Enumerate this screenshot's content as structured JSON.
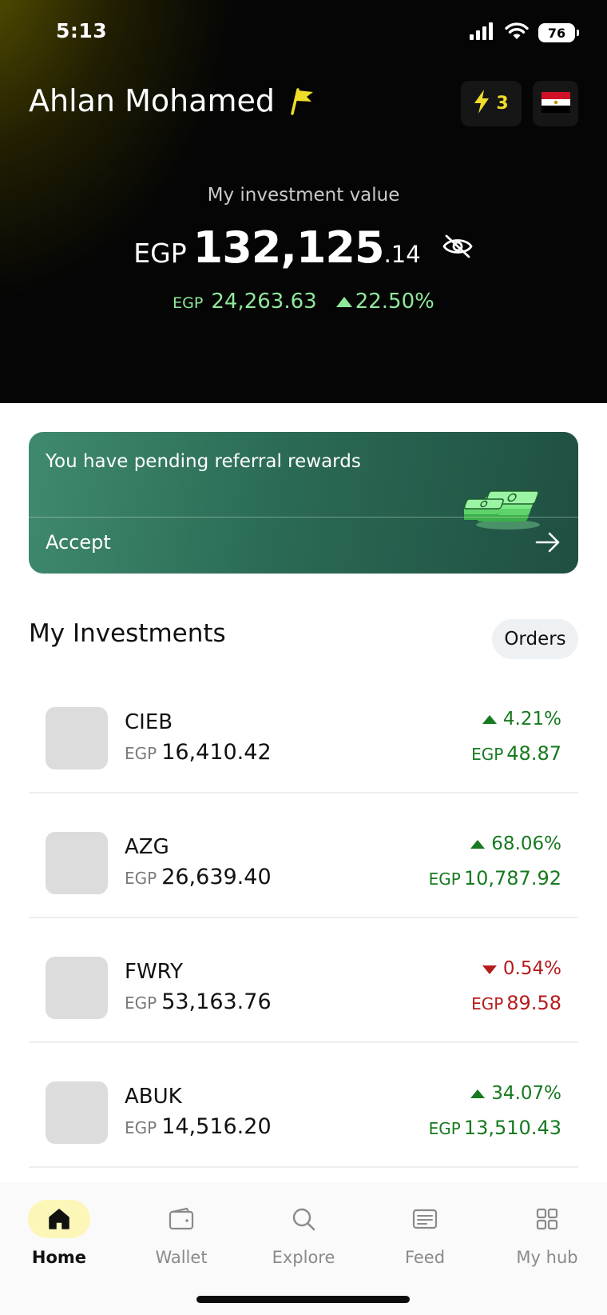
{
  "status_bar": {
    "time": "5:13",
    "battery": "76",
    "icons": [
      "cellular-signal-icon",
      "wifi-icon",
      "battery-icon"
    ]
  },
  "header": {
    "greeting": "Ahlan Mohamed",
    "streak_count": "3",
    "country": "Egypt"
  },
  "portfolio": {
    "label": "My investment value",
    "currency": "EGP",
    "value_main": "132,125",
    "value_decimal": ".14",
    "change_currency": "EGP",
    "change_amount": "24,263.63",
    "change_percent": "22.50%",
    "change_direction": "up"
  },
  "referral": {
    "title": "You have pending referral rewards",
    "action_label": "Accept"
  },
  "investments": {
    "title": "My Investments",
    "orders_label": "Orders",
    "items": [
      {
        "ticker": "CIEB",
        "currency": "EGP",
        "value": "16,410.42",
        "change_pct": "4.21%",
        "change_currency": "EGP",
        "change_amount": "48.87",
        "direction": "up"
      },
      {
        "ticker": "AZG",
        "currency": "EGP",
        "value": "26,639.40",
        "change_pct": "68.06%",
        "change_currency": "EGP",
        "change_amount": "10,787.92",
        "direction": "up"
      },
      {
        "ticker": "FWRY",
        "currency": "EGP",
        "value": "53,163.76",
        "change_pct": "0.54%",
        "change_currency": "EGP",
        "change_amount": "89.58",
        "direction": "down"
      },
      {
        "ticker": "ABUK",
        "currency": "EGP",
        "value": "14,516.20",
        "change_pct": "34.07%",
        "change_currency": "EGP",
        "change_amount": "13,510.43",
        "direction": "up"
      }
    ]
  },
  "bottom_nav": {
    "items": [
      {
        "label": "Home",
        "icon": "home-icon",
        "active": true
      },
      {
        "label": "Wallet",
        "icon": "wallet-icon",
        "active": false
      },
      {
        "label": "Explore",
        "icon": "search-icon",
        "active": false
      },
      {
        "label": "Feed",
        "icon": "feed-icon",
        "active": false
      },
      {
        "label": "My hub",
        "icon": "grid-icon",
        "active": false
      }
    ]
  },
  "colors": {
    "gain": "#177a1f",
    "loss": "#b51c1c",
    "hero_gain": "#8fe89a",
    "accent_yellow": "#f0dd2a",
    "referral_green": "#2b6b55"
  }
}
